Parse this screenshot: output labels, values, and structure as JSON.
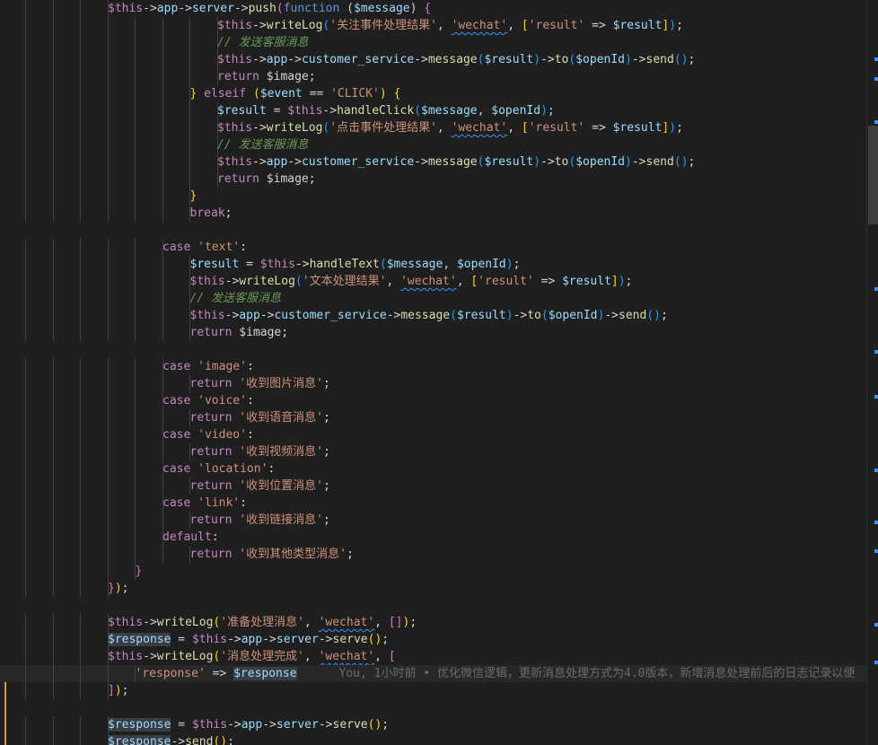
{
  "colors": {
    "var": "#9cdcfe",
    "varThis": "#c586c0",
    "func": "#dcdcaa",
    "str": "#ce9178",
    "kw": "#569cd6",
    "ctrl": "#c586c0",
    "plain": "#d4d4d4",
    "comment": "#6a9955",
    "op": "#d4d4d4",
    "bracket1": "#ffd700",
    "bracket2": "#da70d6",
    "bracket3": "#179fff"
  },
  "lines": [
    {
      "indent": 4,
      "tokens": [
        [
          "$this",
          "var"
        ],
        [
          "->",
          "op"
        ],
        [
          "app",
          "var"
        ],
        [
          "->",
          "op"
        ],
        [
          "server",
          "var"
        ],
        [
          "->",
          "op"
        ],
        [
          "push",
          "func"
        ],
        [
          "(",
          "bracket2"
        ],
        [
          "function",
          "kw"
        ],
        [
          " (",
          "plain"
        ],
        [
          "$message",
          "var"
        ],
        [
          ") ",
          "plain"
        ],
        [
          "{",
          "bracket2"
        ]
      ]
    },
    {
      "indent": 8,
      "tokens": [
        [
          "$this",
          "var"
        ],
        [
          "->",
          "op"
        ],
        [
          "writeLog",
          "func"
        ],
        [
          "(",
          "bracket3"
        ],
        [
          "'关注事件处理结果'",
          "str"
        ],
        [
          ", ",
          "plain"
        ],
        [
          "'wechat'",
          "str_sq"
        ],
        [
          ", ",
          "plain"
        ],
        [
          "[",
          "bracket1"
        ],
        [
          "'result'",
          "str"
        ],
        [
          " => ",
          "plain"
        ],
        [
          "$result",
          "var"
        ],
        [
          "]",
          "bracket1"
        ],
        [
          ")",
          "bracket3"
        ],
        [
          ";",
          "plain"
        ]
      ]
    },
    {
      "indent": 8,
      "tokens": [
        [
          "// 发送客服消息",
          "comment"
        ]
      ]
    },
    {
      "indent": 8,
      "tokens": [
        [
          "$this",
          "var"
        ],
        [
          "->",
          "op"
        ],
        [
          "app",
          "var"
        ],
        [
          "->",
          "op"
        ],
        [
          "customer_service",
          "var"
        ],
        [
          "->",
          "op"
        ],
        [
          "message",
          "func"
        ],
        [
          "(",
          "bracket3"
        ],
        [
          "$result",
          "var"
        ],
        [
          ")",
          "bracket3"
        ],
        [
          "->",
          "op"
        ],
        [
          "to",
          "func"
        ],
        [
          "(",
          "bracket3"
        ],
        [
          "$openId",
          "var"
        ],
        [
          ")",
          "bracket3"
        ],
        [
          "->",
          "op"
        ],
        [
          "send",
          "func"
        ],
        [
          "()",
          "bracket3"
        ],
        [
          ";",
          "plain"
        ]
      ]
    },
    {
      "indent": 8,
      "tokens": [
        [
          "return",
          "ctrl"
        ],
        [
          " $image;",
          "plain"
        ]
      ]
    },
    {
      "indent": 7,
      "tokens": [
        [
          "}",
          "bracket1"
        ],
        [
          " elseif ",
          "ctrl"
        ],
        [
          "(",
          "bracket1"
        ],
        [
          "$event",
          "var"
        ],
        [
          " == ",
          "plain"
        ],
        [
          "'CLICK'",
          "str"
        ],
        [
          ") ",
          "bracket1"
        ],
        [
          "{",
          "bracket1"
        ]
      ]
    },
    {
      "indent": 8,
      "tokens": [
        [
          "$result",
          "var"
        ],
        [
          " = ",
          "plain"
        ],
        [
          "$this",
          "var"
        ],
        [
          "->",
          "op"
        ],
        [
          "handleClick",
          "func"
        ],
        [
          "(",
          "bracket3"
        ],
        [
          "$message",
          "var"
        ],
        [
          ", ",
          "plain"
        ],
        [
          "$openId",
          "var"
        ],
        [
          ")",
          "bracket3"
        ],
        [
          ";",
          "plain"
        ]
      ]
    },
    {
      "indent": 8,
      "tokens": [
        [
          "$this",
          "var"
        ],
        [
          "->",
          "op"
        ],
        [
          "writeLog",
          "func"
        ],
        [
          "(",
          "bracket3"
        ],
        [
          "'点击事件处理结果'",
          "str"
        ],
        [
          ", ",
          "plain"
        ],
        [
          "'wechat'",
          "str_sq"
        ],
        [
          ", ",
          "plain"
        ],
        [
          "[",
          "bracket1"
        ],
        [
          "'result'",
          "str"
        ],
        [
          " => ",
          "plain"
        ],
        [
          "$result",
          "var"
        ],
        [
          "]",
          "bracket1"
        ],
        [
          ")",
          "bracket3"
        ],
        [
          ";",
          "plain"
        ]
      ]
    },
    {
      "indent": 8,
      "tokens": [
        [
          "// 发送客服消息",
          "comment"
        ]
      ]
    },
    {
      "indent": 8,
      "tokens": [
        [
          "$this",
          "var"
        ],
        [
          "->",
          "op"
        ],
        [
          "app",
          "var"
        ],
        [
          "->",
          "op"
        ],
        [
          "customer_service",
          "var"
        ],
        [
          "->",
          "op"
        ],
        [
          "message",
          "func"
        ],
        [
          "(",
          "bracket3"
        ],
        [
          "$result",
          "var"
        ],
        [
          ")",
          "bracket3"
        ],
        [
          "->",
          "op"
        ],
        [
          "to",
          "func"
        ],
        [
          "(",
          "bracket3"
        ],
        [
          "$openId",
          "var"
        ],
        [
          ")",
          "bracket3"
        ],
        [
          "->",
          "op"
        ],
        [
          "send",
          "func"
        ],
        [
          "()",
          "bracket3"
        ],
        [
          ";",
          "plain"
        ]
      ]
    },
    {
      "indent": 8,
      "tokens": [
        [
          "return",
          "ctrl"
        ],
        [
          " $image;",
          "plain"
        ]
      ]
    },
    {
      "indent": 7,
      "tokens": [
        [
          "}",
          "bracket1"
        ]
      ]
    },
    {
      "indent": 7,
      "tokens": [
        [
          "break",
          "ctrl"
        ],
        [
          ";",
          "plain"
        ]
      ]
    },
    {
      "indent": 0,
      "tokens": []
    },
    {
      "indent": 6,
      "tokens": [
        [
          "case",
          "ctrl"
        ],
        [
          " ",
          "plain"
        ],
        [
          "'text'",
          "str"
        ],
        [
          ":",
          "plain"
        ]
      ]
    },
    {
      "indent": 7,
      "tokens": [
        [
          "$result",
          "var"
        ],
        [
          " = ",
          "plain"
        ],
        [
          "$this",
          "var"
        ],
        [
          "->",
          "op"
        ],
        [
          "handleText",
          "func"
        ],
        [
          "(",
          "bracket3"
        ],
        [
          "$message",
          "var"
        ],
        [
          ", ",
          "plain"
        ],
        [
          "$openId",
          "var"
        ],
        [
          ")",
          "bracket3"
        ],
        [
          ";",
          "plain"
        ]
      ]
    },
    {
      "indent": 7,
      "tokens": [
        [
          "$this",
          "var"
        ],
        [
          "->",
          "op"
        ],
        [
          "writeLog",
          "func"
        ],
        [
          "(",
          "bracket3"
        ],
        [
          "'文本处理结果'",
          "str"
        ],
        [
          ", ",
          "plain"
        ],
        [
          "'wechat'",
          "str_sq"
        ],
        [
          ", ",
          "plain"
        ],
        [
          "[",
          "bracket1"
        ],
        [
          "'result'",
          "str"
        ],
        [
          " => ",
          "plain"
        ],
        [
          "$result",
          "var"
        ],
        [
          "]",
          "bracket1"
        ],
        [
          ")",
          "bracket3"
        ],
        [
          ";",
          "plain"
        ]
      ]
    },
    {
      "indent": 7,
      "tokens": [
        [
          "// 发送客服消息",
          "comment"
        ]
      ]
    },
    {
      "indent": 7,
      "tokens": [
        [
          "$this",
          "var"
        ],
        [
          "->",
          "op"
        ],
        [
          "app",
          "var"
        ],
        [
          "->",
          "op"
        ],
        [
          "customer_service",
          "var"
        ],
        [
          "->",
          "op"
        ],
        [
          "message",
          "func"
        ],
        [
          "(",
          "bracket3"
        ],
        [
          "$result",
          "var"
        ],
        [
          ")",
          "bracket3"
        ],
        [
          "->",
          "op"
        ],
        [
          "to",
          "func"
        ],
        [
          "(",
          "bracket3"
        ],
        [
          "$openId",
          "var"
        ],
        [
          ")",
          "bracket3"
        ],
        [
          "->",
          "op"
        ],
        [
          "send",
          "func"
        ],
        [
          "()",
          "bracket3"
        ],
        [
          ";",
          "plain"
        ]
      ]
    },
    {
      "indent": 7,
      "tokens": [
        [
          "return",
          "ctrl"
        ],
        [
          " $image;",
          "plain"
        ]
      ]
    },
    {
      "indent": 0,
      "tokens": []
    },
    {
      "indent": 6,
      "tokens": [
        [
          "case",
          "ctrl"
        ],
        [
          " ",
          "plain"
        ],
        [
          "'image'",
          "str"
        ],
        [
          ":",
          "plain"
        ]
      ]
    },
    {
      "indent": 7,
      "tokens": [
        [
          "return",
          "ctrl"
        ],
        [
          " ",
          "plain"
        ],
        [
          "'收到图片消息'",
          "str"
        ],
        [
          ";",
          "plain"
        ]
      ]
    },
    {
      "indent": 6,
      "tokens": [
        [
          "case",
          "ctrl"
        ],
        [
          " ",
          "plain"
        ],
        [
          "'voice'",
          "str"
        ],
        [
          ":",
          "plain"
        ]
      ]
    },
    {
      "indent": 7,
      "tokens": [
        [
          "return",
          "ctrl"
        ],
        [
          " ",
          "plain"
        ],
        [
          "'收到语音消息'",
          "str"
        ],
        [
          ";",
          "plain"
        ]
      ]
    },
    {
      "indent": 6,
      "tokens": [
        [
          "case",
          "ctrl"
        ],
        [
          " ",
          "plain"
        ],
        [
          "'video'",
          "str"
        ],
        [
          ":",
          "plain"
        ]
      ]
    },
    {
      "indent": 7,
      "tokens": [
        [
          "return",
          "ctrl"
        ],
        [
          " ",
          "plain"
        ],
        [
          "'收到视频消息'",
          "str"
        ],
        [
          ";",
          "plain"
        ]
      ]
    },
    {
      "indent": 6,
      "tokens": [
        [
          "case",
          "ctrl"
        ],
        [
          " ",
          "plain"
        ],
        [
          "'location'",
          "str"
        ],
        [
          ":",
          "plain"
        ]
      ]
    },
    {
      "indent": 7,
      "tokens": [
        [
          "return",
          "ctrl"
        ],
        [
          " ",
          "plain"
        ],
        [
          "'收到位置消息'",
          "str"
        ],
        [
          ";",
          "plain"
        ]
      ]
    },
    {
      "indent": 6,
      "tokens": [
        [
          "case",
          "ctrl"
        ],
        [
          " ",
          "plain"
        ],
        [
          "'link'",
          "str"
        ],
        [
          ":",
          "plain"
        ]
      ]
    },
    {
      "indent": 7,
      "tokens": [
        [
          "return",
          "ctrl"
        ],
        [
          " ",
          "plain"
        ],
        [
          "'收到链接消息'",
          "str"
        ],
        [
          ";",
          "plain"
        ]
      ]
    },
    {
      "indent": 6,
      "tokens": [
        [
          "default",
          "ctrl"
        ],
        [
          ":",
          "plain"
        ]
      ]
    },
    {
      "indent": 7,
      "tokens": [
        [
          "return",
          "ctrl"
        ],
        [
          " ",
          "plain"
        ],
        [
          "'收到其他类型消息'",
          "str"
        ],
        [
          ";",
          "plain"
        ]
      ]
    },
    {
      "indent": 5,
      "tokens": [
        [
          "}",
          "bracket2"
        ]
      ]
    },
    {
      "indent": 4,
      "tokens": [
        [
          "}",
          "bracket2"
        ],
        [
          ")",
          "bracket1"
        ],
        [
          ";",
          "plain"
        ]
      ]
    },
    {
      "indent": 0,
      "tokens": []
    },
    {
      "indent": 4,
      "tokens": [
        [
          "$this",
          "var"
        ],
        [
          "->",
          "op"
        ],
        [
          "writeLog",
          "func"
        ],
        [
          "(",
          "bracket1"
        ],
        [
          "'准备处理消息'",
          "str"
        ],
        [
          ", ",
          "plain"
        ],
        [
          "'wechat'",
          "str_sq"
        ],
        [
          ", ",
          "plain"
        ],
        [
          "[]",
          "bracket2"
        ],
        [
          ")",
          "bracket1"
        ],
        [
          ";",
          "plain"
        ]
      ]
    },
    {
      "indent": 4,
      "tokens": [
        [
          "$response",
          "var_sel"
        ],
        [
          " = ",
          "plain"
        ],
        [
          "$this",
          "var"
        ],
        [
          "->",
          "op"
        ],
        [
          "app",
          "var"
        ],
        [
          "->",
          "op"
        ],
        [
          "server",
          "var"
        ],
        [
          "->",
          "op"
        ],
        [
          "serve",
          "func"
        ],
        [
          "()",
          "bracket1"
        ],
        [
          ";",
          "plain"
        ]
      ]
    },
    {
      "indent": 4,
      "tokens": [
        [
          "$this",
          "var"
        ],
        [
          "->",
          "op"
        ],
        [
          "writeLog",
          "func"
        ],
        [
          "(",
          "bracket1"
        ],
        [
          "'消息处理完成'",
          "str"
        ],
        [
          ", ",
          "plain"
        ],
        [
          "'wechat'",
          "str_sq"
        ],
        [
          ", ",
          "plain"
        ],
        [
          "[",
          "bracket2"
        ]
      ]
    },
    {
      "indent": 5,
      "current": true,
      "tokens": [
        [
          "'response'",
          "str"
        ],
        [
          " => ",
          "plain"
        ],
        [
          "$response",
          "var_sel"
        ]
      ],
      "blame": "You, 1小时前 • 优化微信逻辑，更新消息处理方式为4.0版本，新增消息处理前后的日志记录以便"
    },
    {
      "indent": 4,
      "tokens": [
        [
          "]",
          "bracket2"
        ],
        [
          ")",
          "bracket1"
        ],
        [
          ";",
          "plain"
        ]
      ]
    },
    {
      "indent": 0,
      "tokens": []
    },
    {
      "indent": 4,
      "tokens": [
        [
          "$response",
          "var_sel"
        ],
        [
          " = ",
          "plain"
        ],
        [
          "$this",
          "var"
        ],
        [
          "->",
          "op"
        ],
        [
          "app",
          "var"
        ],
        [
          "->",
          "op"
        ],
        [
          "server",
          "var"
        ],
        [
          "->",
          "op"
        ],
        [
          "serve",
          "func"
        ],
        [
          "()",
          "bracket1"
        ],
        [
          ";",
          "plain"
        ]
      ]
    },
    {
      "indent": 4,
      "tokens": [
        [
          "$response",
          "var_sel"
        ],
        [
          "->",
          "op"
        ],
        [
          "send",
          "func"
        ],
        [
          "()",
          "bracket1"
        ],
        [
          ";",
          "plain"
        ]
      ]
    }
  ]
}
